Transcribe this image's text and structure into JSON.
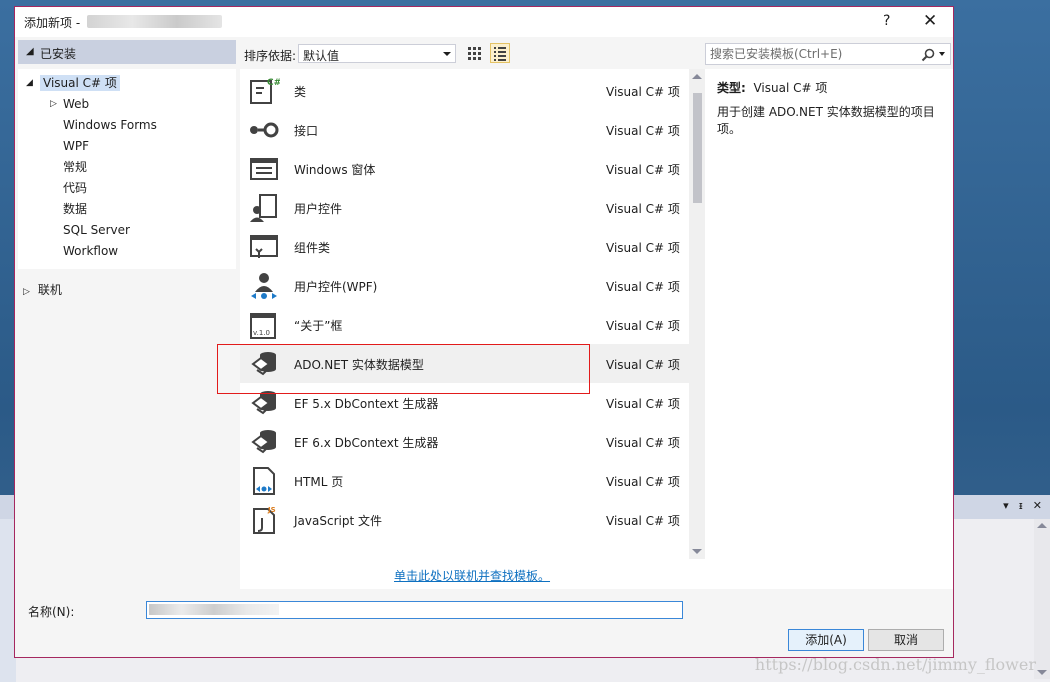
{
  "dialog": {
    "title": "添加新项 -",
    "help_label": "?",
    "close_label": "✕"
  },
  "left": {
    "installed": "已安装",
    "root": "Visual C# 项",
    "children": [
      "Web",
      "Windows Forms",
      "WPF",
      "常规",
      "代码",
      "数据",
      "SQL Server",
      "Workflow"
    ],
    "online": "联机"
  },
  "sortbar": {
    "label": "排序依据:",
    "value": "默认值"
  },
  "search": {
    "placeholder": "搜索已安装模板(Ctrl+E)"
  },
  "templates": [
    {
      "name": "类",
      "category": "Visual C# 项",
      "icon": "class-icon"
    },
    {
      "name": "接口",
      "category": "Visual C# 项",
      "icon": "interface-icon"
    },
    {
      "name": "Windows 窗体",
      "category": "Visual C# 项",
      "icon": "windows-form-icon"
    },
    {
      "name": "用户控件",
      "category": "Visual C# 项",
      "icon": "user-control-icon"
    },
    {
      "name": "组件类",
      "category": "Visual C# 项",
      "icon": "component-class-icon"
    },
    {
      "name": "用户控件(WPF)",
      "category": "Visual C# 项",
      "icon": "wpf-user-control-icon"
    },
    {
      "name": "“关于”框",
      "category": "Visual C# 项",
      "icon": "about-box-icon"
    },
    {
      "name": "ADO.NET 实体数据模型",
      "category": "Visual C# 项",
      "icon": "entity-model-icon"
    },
    {
      "name": "EF 5.x DbContext 生成器",
      "category": "Visual C# 项",
      "icon": "entity-model-icon"
    },
    {
      "name": "EF 6.x DbContext 生成器",
      "category": "Visual C# 项",
      "icon": "entity-model-icon"
    },
    {
      "name": "HTML 页",
      "category": "Visual C# 项",
      "icon": "html-page-icon"
    },
    {
      "name": "JavaScript 文件",
      "category": "Visual C# 项",
      "icon": "javascript-file-icon"
    }
  ],
  "online_link": "单击此处以联机并查找模板。",
  "details": {
    "type_label": "类型:",
    "type_value": "Visual C# 项",
    "description": "用于创建 ADO.NET 实体数据模型的项目项。"
  },
  "bottom": {
    "name_label": "名称(N):",
    "add_button": "添加(A)",
    "cancel_button": "取消"
  },
  "watermark": "https://blog.csdn.net/jimmy_flower",
  "colors": {
    "accent_border": "#a5285f",
    "highlight_box": "#e21b1b",
    "link": "#0e70c0",
    "installed_header": "#c9d0e0"
  }
}
